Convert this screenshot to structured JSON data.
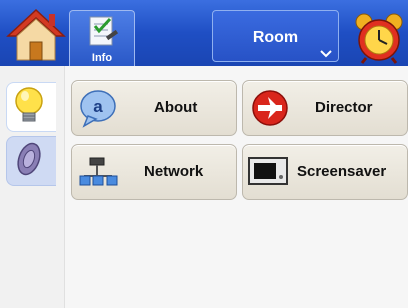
{
  "header": {
    "home_icon": "home-icon",
    "info_label": "Info",
    "info_icon": "info-checklist-icon",
    "room_label": "Room",
    "alarm_icon": "alarm-clock-icon"
  },
  "sidebar": {
    "items": [
      {
        "icon": "lightbulb-icon",
        "state": "active"
      },
      {
        "icon": "speaker-icon",
        "state": "inactive"
      }
    ]
  },
  "tiles": [
    {
      "label": "About",
      "icon": "about-icon"
    },
    {
      "label": "Director",
      "icon": "director-icon"
    },
    {
      "label": "Network",
      "icon": "network-icon"
    },
    {
      "label": "Screensaver",
      "icon": "screensaver-icon"
    }
  ],
  "colors": {
    "header_blue": "#1f4fc4",
    "tile_bg": "#e9e5da",
    "director_red": "#d9261c"
  }
}
